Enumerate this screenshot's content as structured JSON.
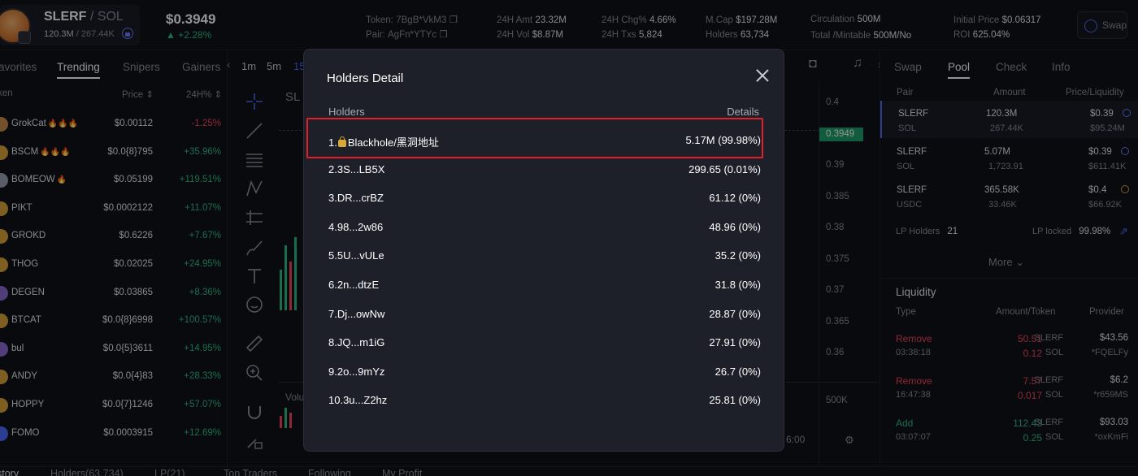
{
  "token": {
    "name": "SLERF",
    "sep": "/",
    "quote": "SOL",
    "liq_base": "120.3M",
    "liq_sep": "/",
    "liq_quote": "267.44K",
    "price": "$0.3949",
    "change": "+2.28%"
  },
  "stats": {
    "token_lbl": "Token:",
    "token_val": "7BgB*VkM3",
    "pair_lbl": "Pair:",
    "pair_val": "AgFn*YTYc",
    "amt_lbl": "24H Amt",
    "amt_val": "23.32M",
    "vol_lbl": "24H Vol",
    "vol_val": "$8.87M",
    "chg_lbl": "24H Chg%",
    "chg_val": "4.66%",
    "txs_lbl": "24H Txs",
    "txs_val": "5,824",
    "mcap_lbl": "M.Cap",
    "mcap_val": "$197.28M",
    "holders_lbl": "Holders",
    "holders_val": "63,734",
    "circ_lbl": "Circulation",
    "circ_val": "500M",
    "total_lbl": "Total /Mintable",
    "total_val": "500M/No",
    "init_lbl": "Initial Price",
    "init_val": "$0.06317",
    "roi_lbl": "ROI",
    "roi_val": "625.04%",
    "swap_btn": "Swap"
  },
  "left": {
    "tabs": [
      "avorites",
      "Trending",
      "Snipers",
      "Gainers"
    ],
    "head_token": "ken",
    "head_price": "Price",
    "head_change": "24H%",
    "rows": [
      {
        "name": "GrokCat",
        "fire": "🔥🔥🔥",
        "price": "$0.00112",
        "change": "-1.25%",
        "dir": "down",
        "color": "#c98a4a"
      },
      {
        "name": "BSCM",
        "fire": "🔥🔥🔥",
        "price": "$0.0{8}795",
        "change": "+35.96%",
        "dir": "up",
        "color": "#d9a43a"
      },
      {
        "name": "BOMEOW",
        "fire": "🔥",
        "price": "$0.05199",
        "change": "+119.51%",
        "dir": "up",
        "color": "#9aa0b4"
      },
      {
        "name": "PIKT",
        "fire": "",
        "price": "$0.0002122",
        "change": "+11.07%",
        "dir": "up",
        "color": "#d9a43a"
      },
      {
        "name": "GROKD",
        "fire": "",
        "price": "$0.6226",
        "change": "+7.67%",
        "dir": "up",
        "color": "#d9a43a"
      },
      {
        "name": "THOG",
        "fire": "",
        "price": "$0.02025",
        "change": "+24.95%",
        "dir": "up",
        "color": "#d9a43a"
      },
      {
        "name": "DEGEN",
        "fire": "",
        "price": "$0.03865",
        "change": "+8.36%",
        "dir": "up",
        "color": "#8a6ad0"
      },
      {
        "name": "BTCAT",
        "fire": "",
        "price": "$0.0{8}6998",
        "change": "+100.57%",
        "dir": "up",
        "color": "#d9a43a"
      },
      {
        "name": "bul",
        "fire": "",
        "price": "$0.0{5}3611",
        "change": "+14.95%",
        "dir": "up",
        "color": "#8a6ad0"
      },
      {
        "name": "ANDY",
        "fire": "",
        "price": "$0.0{4}83",
        "change": "+28.33%",
        "dir": "up",
        "color": "#d9a43a"
      },
      {
        "name": "HOPPY",
        "fire": "",
        "price": "$0.0{7}1246",
        "change": "+57.07%",
        "dir": "up",
        "color": "#d9a43a"
      },
      {
        "name": "FOMO",
        "fire": "",
        "price": "$0.0003915",
        "change": "+12.69%",
        "dir": "up",
        "color": "#4d6bff"
      }
    ]
  },
  "chart": {
    "intervals": [
      "1m",
      "5m",
      "15"
    ],
    "pair_label": "SL",
    "axis": [
      "0.4",
      "0.39",
      "0.385",
      "0.38",
      "0.375",
      "0.37",
      "0.365",
      "0.36",
      "500K"
    ],
    "price_tag": "0.3949",
    "vol_label": "Volu",
    "time_label": "6:00"
  },
  "right": {
    "tabs": [
      "Swap",
      "Pool",
      "Check",
      "Info"
    ],
    "head_pair": "Pair",
    "head_amount": "Amount",
    "head_pl": "Price/Liquidity",
    "pools": [
      {
        "base": "SLERF",
        "quote": "SOL",
        "amt1": "120.3M",
        "amt2": "267.44K",
        "price": "$0.39",
        "liq": "$95.24M"
      },
      {
        "base": "SLERF",
        "quote": "SOL",
        "amt1": "5.07M",
        "amt2": "1,723.91",
        "price": "$0.39",
        "liq": "$611.41K"
      },
      {
        "base": "SLERF",
        "quote": "USDC",
        "amt1": "365.58K",
        "amt2": "33.46K",
        "price": "$0.4",
        "liq": "$66.92K"
      }
    ],
    "lp_holders_lbl": "LP Holders",
    "lp_holders_val": "21",
    "lp_locked_lbl": "LP locked",
    "lp_locked_val": "99.98%",
    "more": "More",
    "liq_title": "Liquidity",
    "liq_head_type": "Type",
    "liq_head_amt": "Amount/Token",
    "liq_head_prov": "Provider",
    "liq_rows": [
      {
        "type": "Remove",
        "time": "03:38:18",
        "a1": "50.51",
        "t1": "SLERF",
        "a2": "0.12",
        "t2": "SOL",
        "usd": "$43.56",
        "prov": "*FQELFy",
        "dir": "down"
      },
      {
        "type": "Remove",
        "time": "16:47:38",
        "a1": "7.57",
        "t1": "SLERF",
        "a2": "0.017",
        "t2": "SOL",
        "usd": "$6.2",
        "prov": "*r659MS",
        "dir": "down"
      },
      {
        "type": "Add",
        "time": "03:07:07",
        "a1": "112.43",
        "t1": "SLERF",
        "a2": "0.25",
        "t2": "SOL",
        "usd": "$93.03",
        "prov": "*oxKmFi",
        "dir": "up"
      }
    ]
  },
  "bottom_tabs": [
    "story",
    "Holders(63,734)",
    "LP(21)",
    "Top Traders",
    "Following",
    "My Profit"
  ],
  "modal": {
    "title": "Holders Detail",
    "head_holders": "Holders",
    "head_details": "Details",
    "rows": [
      {
        "rank": "1.",
        "addr": "Blackhole/黑洞地址",
        "locked": true,
        "detail": "5.17M (99.98%)"
      },
      {
        "rank": "2.",
        "addr": "3S...LB5X",
        "locked": false,
        "detail": "299.65 (0.01%)"
      },
      {
        "rank": "3.",
        "addr": "DR...crBZ",
        "locked": false,
        "detail": "61.12 (0%)"
      },
      {
        "rank": "4.",
        "addr": "98...2w86",
        "locked": false,
        "detail": "48.96 (0%)"
      },
      {
        "rank": "5.",
        "addr": "5U...vULe",
        "locked": false,
        "detail": "35.2 (0%)"
      },
      {
        "rank": "6.",
        "addr": "2n...dtzE",
        "locked": false,
        "detail": "31.8 (0%)"
      },
      {
        "rank": "7.",
        "addr": "Dj...owNw",
        "locked": false,
        "detail": "28.87 (0%)"
      },
      {
        "rank": "8.",
        "addr": "JQ...m1iG",
        "locked": false,
        "detail": "27.91 (0%)"
      },
      {
        "rank": "9.",
        "addr": "2o...9mYz",
        "locked": false,
        "detail": "26.7 (0%)"
      },
      {
        "rank": "10.",
        "addr": "3u...Z2hz",
        "locked": false,
        "detail": "25.81 (0%)"
      }
    ]
  },
  "colors": {
    "up": "#2ebd85",
    "down": "#f6465d",
    "accent": "#4d6bff",
    "highlight": "#e0202a"
  }
}
